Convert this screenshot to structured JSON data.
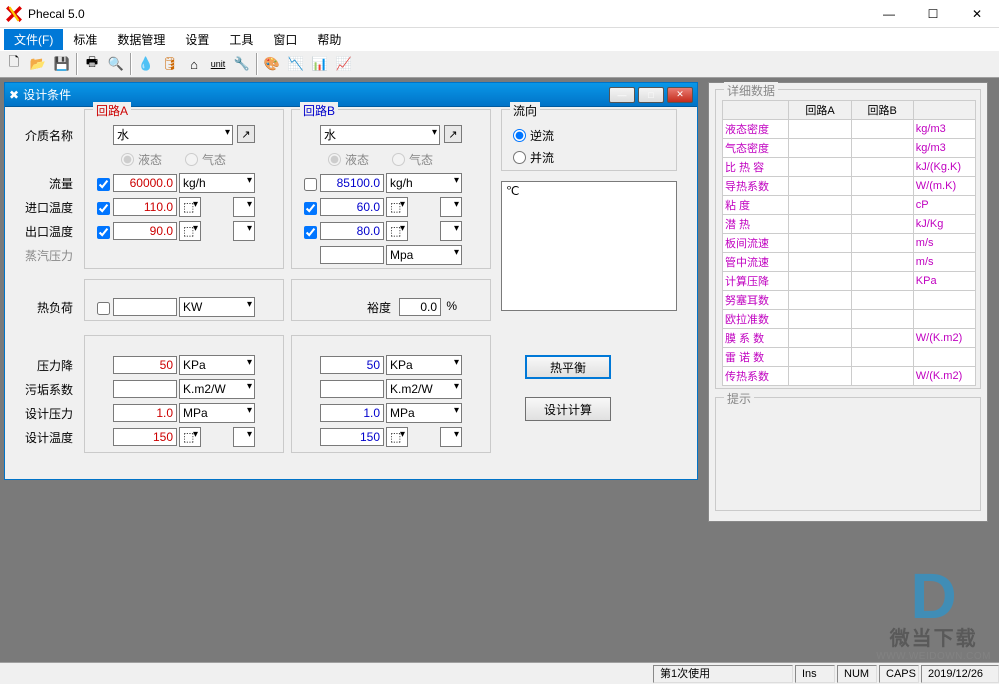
{
  "app": {
    "title": "Phecal 5.0"
  },
  "menu": [
    "文件(F)",
    "标准",
    "数据管理",
    "设置",
    "工具",
    "窗口",
    "帮助"
  ],
  "childwin": {
    "title": "设计条件"
  },
  "labels": {
    "loopA": "回路A",
    "loopB": "回路B",
    "flow_dir": "流向",
    "medium": "介质名称",
    "liquid": "液态",
    "gas": "气态",
    "flow": "流量",
    "inletT": "进口温度",
    "outletT": "出口温度",
    "steamP": "蒸汽压力",
    "heatload": "热负荷",
    "margin": "裕度",
    "pct": "%",
    "pressdrop": "压力降",
    "fouling": "污垢系数",
    "designP": "设计压力",
    "designT": "设计温度",
    "reverse": "逆流",
    "parallel": "并流",
    "tempC": "℃",
    "btn_balance": "热平衡",
    "btn_calc": "设计计算"
  },
  "A": {
    "medium": "水",
    "flow": "60000.0",
    "flowU": "kg/h",
    "inT": "110.0",
    "outT": "90.0",
    "steamU": "",
    "pd": "50",
    "pdU": "KPa",
    "foul": "",
    "foulU": "K.m2/W",
    "dp": "1.0",
    "dpU": "MPa",
    "dt": "150"
  },
  "B": {
    "medium": "水",
    "flow": "85100.0",
    "flowU": "kg/h",
    "inT": "60.0",
    "outT": "80.0",
    "steamU": "Mpa",
    "pd": "50",
    "pdU": "KPa",
    "foul": "",
    "foulU": "K.m2/W",
    "dp": "1.0",
    "dpU": "MPa",
    "dt": "150"
  },
  "heatload": {
    "val": "",
    "unit": "KW"
  },
  "margin": "0.0",
  "side": {
    "title": "详细数据",
    "hA": "回路A",
    "hB": "回路B",
    "hint": "提示",
    "rows": [
      {
        "n": "液态密度",
        "u": "kg/m3"
      },
      {
        "n": "气态密度",
        "u": "kg/m3"
      },
      {
        "n": "比 热 容",
        "u": "kJ/(Kg.K)"
      },
      {
        "n": "导热系数",
        "u": "W/(m.K)"
      },
      {
        "n": "粘    度",
        "u": "cP"
      },
      {
        "n": "潜    热",
        "u": "kJ/Kg"
      },
      {
        "n": "板间流速",
        "u": "m/s"
      },
      {
        "n": "管中流速",
        "u": "m/s"
      },
      {
        "n": "计算压降",
        "u": "KPa"
      },
      {
        "n": "努塞耳数",
        "u": ""
      },
      {
        "n": "欧拉准数",
        "u": ""
      },
      {
        "n": "膜 系 数",
        "u": "W/(K.m2)"
      },
      {
        "n": "雷 诺 数",
        "u": ""
      },
      {
        "n": "传热系数",
        "u": "W/(K.m2)"
      }
    ]
  },
  "status": {
    "usage": "第1次使用",
    "ins": "Ins",
    "num": "NUM",
    "caps": "CAPS",
    "date": "2019/12/26"
  },
  "wm": {
    "name": "微当下载",
    "url": "WWW.WEIDOWN.COM"
  }
}
